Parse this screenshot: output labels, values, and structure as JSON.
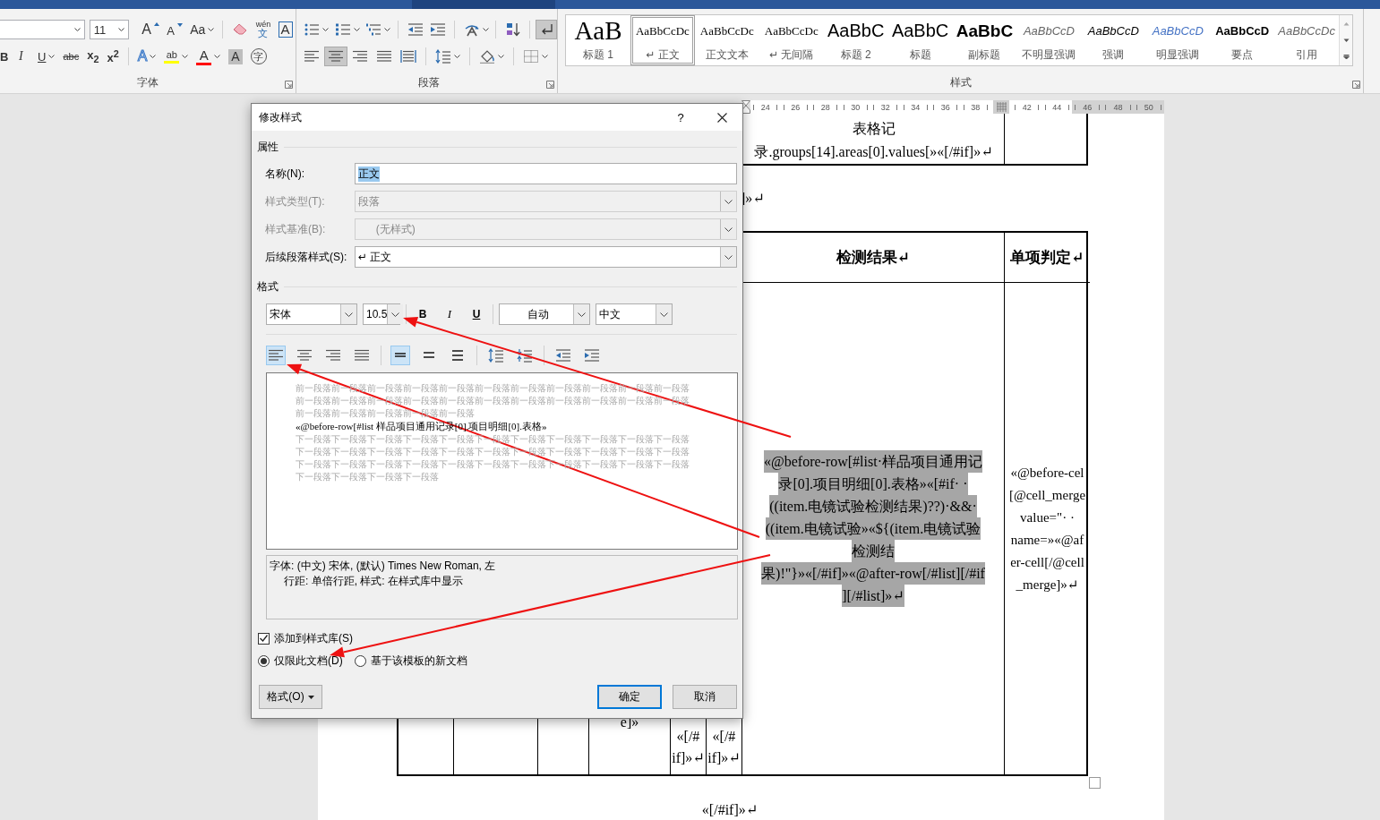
{
  "ribbon": {
    "font_group": {
      "label": "字体",
      "font_size": "11",
      "row1": [
        {
          "kind": "grow",
          "label": "A"
        },
        {
          "kind": "shrink",
          "label": "A"
        },
        {
          "kind": "change-case",
          "label": "Aa",
          "menu": true
        },
        {
          "kind": "clear"
        },
        {
          "kind": "phonetic",
          "label": "wén",
          "sub": "文"
        },
        {
          "kind": "border",
          "label": "A"
        }
      ],
      "row2": [
        {
          "kind": "bold",
          "label": "B"
        },
        {
          "kind": "italic",
          "label": "I"
        },
        {
          "kind": "underline",
          "label": "U",
          "menu": true
        },
        {
          "kind": "strike",
          "label": "abc"
        },
        {
          "kind": "subscript",
          "label": "x$_{2}$"
        },
        {
          "kind": "superscript",
          "label": "x$^{2}$"
        },
        {
          "kind": "effects",
          "label": "A",
          "menu": true
        },
        {
          "kind": "highlight",
          "label": "ab",
          "color": "#ffff00",
          "menu": true
        },
        {
          "kind": "font-color",
          "label": "A",
          "color": "#ff0000",
          "menu": true
        },
        {
          "kind": "shading",
          "label": "A"
        },
        {
          "kind": "enclose",
          "label": "字"
        }
      ]
    },
    "paragraph_group": {
      "label": "段落",
      "rows": [
        [
          [
            {
              "kind": "bullets",
              "menu": true,
              "pressed": false
            },
            {
              "kind": "numbering",
              "menu": true,
              "pressed": false
            },
            {
              "kind": "multilevel",
              "menu": true,
              "pressed": false
            }
          ],
          [
            {
              "kind": "outdent",
              "pressed": false
            },
            {
              "kind": "indent",
              "pressed": false
            }
          ],
          [
            {
              "kind": "asian-layout",
              "menu": true,
              "pressed": false
            }
          ],
          [
            {
              "kind": "sort",
              "pressed": false
            }
          ],
          [
            {
              "kind": "show-marks",
              "pressed": true
            }
          ]
        ],
        [
          [
            {
              "kind": "align-left",
              "pressed": false
            },
            {
              "kind": "center",
              "pressed": true
            },
            {
              "kind": "align-right",
              "pressed": false
            },
            {
              "kind": "justify",
              "pressed": false
            },
            {
              "kind": "distributed",
              "pressed": false
            }
          ],
          [
            {
              "kind": "line-spacing",
              "menu": true,
              "pressed": false
            }
          ],
          [
            {
              "kind": "shading",
              "menu": true,
              "pressed": false
            }
          ],
          [
            {
              "kind": "borders",
              "menu": true,
              "pressed": false
            }
          ]
        ]
      ]
    },
    "styles_group": {
      "label": "样式",
      "items": [
        {
          "kind": "heading-1",
          "preview": "AaB",
          "name": "标题 1",
          "selected": false
        },
        {
          "kind": "normal",
          "preview": "AaBbCcDc",
          "name": "↵ 正文",
          "selected": true
        },
        {
          "kind": "body-text",
          "preview": "AaBbCcDc",
          "name": "正文文本",
          "selected": false
        },
        {
          "kind": "no-spacing",
          "preview": "AaBbCcDc",
          "name": "↵ 无间隔",
          "selected": false
        },
        {
          "kind": "heading-2",
          "preview": "AaBbC",
          "name": "标题 2",
          "selected": false
        },
        {
          "kind": "title",
          "preview": "AaBbC",
          "name": "标题",
          "selected": false
        },
        {
          "kind": "subtitle",
          "preview": "AaBbC",
          "name": "副标题",
          "selected": false
        },
        {
          "kind": "subtle-emphasis",
          "preview": "AaBbCcD",
          "name": "不明显强调",
          "selected": false
        },
        {
          "kind": "emphasis",
          "preview": "AaBbCcD",
          "name": "强调",
          "selected": false
        },
        {
          "kind": "intense-emphasis",
          "preview": "AaBbCcD",
          "name": "明显强调",
          "selected": false
        },
        {
          "kind": "strong",
          "preview": "AaBbCcD",
          "name": "要点",
          "selected": false
        },
        {
          "kind": "quote",
          "preview": "AaBbCcDc",
          "name": "引用",
          "selected": false
        }
      ]
    }
  },
  "document": {
    "ruler": [
      {
        "kind": "number",
        "label": "24",
        "margin": false
      },
      {
        "kind": "number",
        "label": "26",
        "margin": false
      },
      {
        "kind": "number",
        "label": "28",
        "margin": false
      },
      {
        "kind": "number",
        "label": "30",
        "margin": false
      },
      {
        "kind": "number",
        "label": "32",
        "margin": false
      },
      {
        "kind": "number",
        "label": "34",
        "margin": false
      },
      {
        "kind": "number",
        "label": "36",
        "margin": false
      },
      {
        "kind": "number",
        "label": "38",
        "margin": false
      },
      {
        "kind": "column-marker"
      },
      {
        "kind": "number",
        "label": "42",
        "margin": false
      },
      {
        "kind": "number",
        "label": "44",
        "margin": false
      },
      {
        "kind": "number",
        "label": "46",
        "margin": true
      },
      {
        "kind": "number",
        "label": "48",
        "margin": true
      },
      {
        "kind": "number",
        "label": "50",
        "margin": true
      }
    ],
    "top_table_cell": [
      "表格记",
      "录.groups[14].areas[0].values[»«[/#if]»↵"
    ],
    "fragment": "]»↵",
    "table": {
      "headers": [
        {
          "text": "检测结果↵"
        },
        {
          "text": "单项判定↵"
        }
      ],
      "body": [
        {
          "lines": [
            "e]»"
          ],
          "highlighted": false
        },
        {
          "lines": [
            "«[/#",
            "if]»↵"
          ],
          "highlighted": false
        },
        {
          "lines": [
            "«[/#",
            "if]»↵"
          ],
          "highlighted": false
        },
        {
          "lines": [
            "«@before-row[#list·样品项目通用记",
            "录[0].项目明细[0].表格»«[#if· ·",
            "((item.电镜试验检测结果)??)·&&·",
            "((item.电镜试验»«${(item.电镜试验",
            "检测结",
            "果)!\"}»«[/#if]»«@after-row[/#list][/#if",
            "][/#list]»↵"
          ],
          "highlighted": true
        },
        {
          "lines": [
            "«@before-cel",
            "[@cell_merge",
            "value=\"· ·",
            "name=»«@af",
            "er-cell[/@cell",
            "_merge]»↵"
          ],
          "highlighted": false
        }
      ]
    },
    "closing": "«[/#if]»↵"
  },
  "dialog": {
    "title": "修改样式",
    "help": "?",
    "properties": {
      "heading": "属性",
      "rows": [
        {
          "label": "名称(N):",
          "value": "正文",
          "kind": "text",
          "disabled": false,
          "highlighted": true
        },
        {
          "label": "样式类型(T):",
          "value": "段落",
          "kind": "select",
          "disabled": true,
          "highlighted": false
        },
        {
          "label": "样式基准(B):",
          "value": "(无样式)",
          "kind": "select",
          "disabled": true,
          "highlighted": false
        },
        {
          "label": "后续段落样式(S):",
          "value": "↵ 正文",
          "kind": "select",
          "disabled": false,
          "highlighted": false
        }
      ]
    },
    "format": {
      "heading": "格式",
      "font": "宋体",
      "size": "10.5",
      "style_buttons": [
        {
          "kind": "bold",
          "label": "B"
        },
        {
          "kind": "italic",
          "label": "I"
        },
        {
          "kind": "underline",
          "label": "U"
        }
      ],
      "color_setting": "自动",
      "script": "中文",
      "paragraph_buttons": [
        [
          {
            "kind": "align-left",
            "selected": true
          },
          {
            "kind": "align-center",
            "selected": false
          },
          {
            "kind": "align-right",
            "selected": false
          },
          {
            "kind": "justify",
            "selected": false
          }
        ],
        [
          {
            "kind": "spacing-single",
            "selected": true
          },
          {
            "kind": "spacing-onehalf",
            "selected": false
          },
          {
            "kind": "spacing-double",
            "selected": false
          }
        ],
        [
          {
            "kind": "space-increase",
            "selected": false
          },
          {
            "kind": "space-decrease",
            "selected": false
          }
        ],
        [
          {
            "kind": "outdent",
            "selected": false
          },
          {
            "kind": "indent",
            "selected": false
          }
        ]
      ]
    },
    "preview": {
      "before": "前一段落前一段落前一段落前一段落前一段落前一段落前一段落前一段落前一段落前一段落前一段落前一段落前一段落前一段落前一段落前一段落前一段落前一段落前一段落前一段落前一段落前一段落前一段落前一段落前一段落前一段落前一段落",
      "sample": "«@before-row[#list 样品项目通用记录[0].项目明细[0].表格»",
      "after": "下一段落下一段落下一段落下一段落下一段落下一段落下一段落下一段落下一段落下一段落下一段落下一段落下一段落下一段落下一段落下一段落下一段落下一段落下一段落下一段落下一段落下一段落下一段落下一段落下一段落下一段落下一段落下一段落下一段落下一段落下一段落下一段落下一段落下一段落下一段落下一段落下一段落"
    },
    "description": [
      "字体: (中文) 宋体, (默认) Times New Roman, 左",
      "行距: 单倍行距, 样式: 在样式库中显示"
    ],
    "add_to_gallery": {
      "label": "添加到样式库(S)",
      "checked": true
    },
    "scope": [
      {
        "label": "仅限此文档(D)",
        "selected": true
      },
      {
        "label": "基于该模板的新文档",
        "selected": false
      }
    ],
    "buttons": [
      {
        "label": "格式(O)",
        "kind": "menu"
      },
      {
        "label": "确定",
        "kind": "default"
      },
      {
        "label": "取消",
        "kind": "normal"
      }
    ]
  }
}
